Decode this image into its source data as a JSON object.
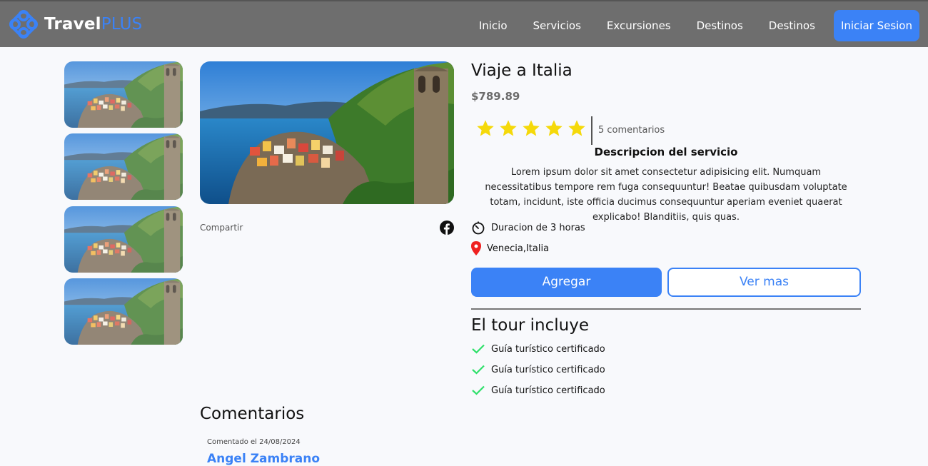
{
  "navbar": {
    "brand_part1": "Travel",
    "brand_part2": "PLUS",
    "links": [
      "Inicio",
      "Servicios",
      "Excursiones",
      "Destinos",
      "Destinos"
    ],
    "login_label": "Iniciar Sesion",
    "accent_color": "#3b82f6"
  },
  "gallery": {
    "thumbnail_count": 4
  },
  "share": {
    "label": "Compartir",
    "icon": "facebook-icon"
  },
  "product": {
    "title": "Viaje a Italia",
    "price": "$789.89",
    "rating": 5,
    "rating_max": 5,
    "comments_count": "5 comentarios",
    "description_title": "Descripcion del servicio",
    "description": "Lorem ipsum dolor sit amet consectetur adipisicing elit. Numquam necessitatibus tempore rem fuga consequuntur! Beatae quibusdam voluptate totam, incidunt, iste officia ducimus consequuntur aperiam eveniet quaerat explicabo! Blanditiis, quis quas.",
    "duration": "Duracion de 3 horas",
    "location": "Venecia,Italia",
    "add_button": "Agregar",
    "more_button": "Ver mas"
  },
  "includes": {
    "title": "El tour incluye",
    "items": [
      "Guía turístico certificado",
      "Guía turístico certificado",
      "Guía turístico certificado"
    ]
  },
  "comments": {
    "title": "Comentarios",
    "first_date": "Comentado el 24/08/2024",
    "first_author": "Angel Zambrano"
  }
}
